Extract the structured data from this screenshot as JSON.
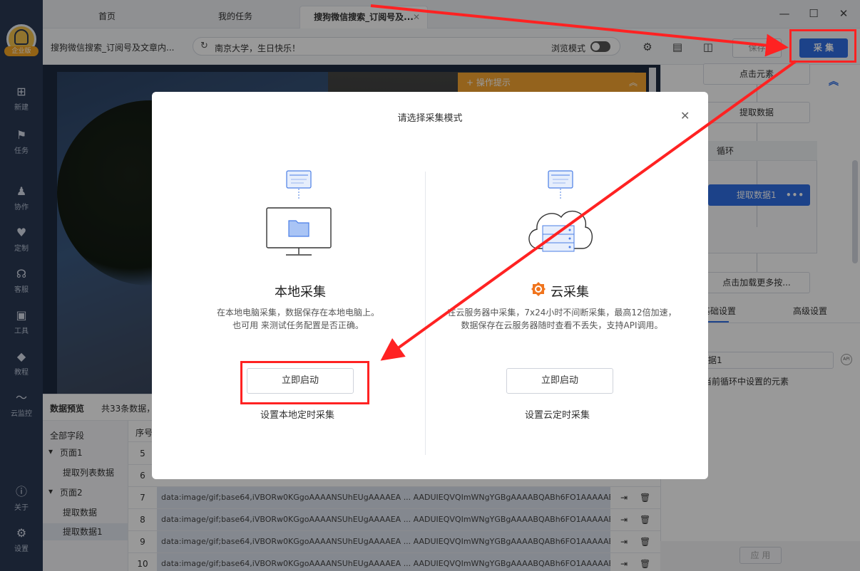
{
  "sidebar": {
    "logo_tag": "企业版",
    "items": [
      {
        "label": "新建",
        "icon": "plus-square-icon"
      },
      {
        "label": "任务",
        "icon": "task-flag-icon"
      },
      {
        "label": "协作",
        "icon": "users-icon"
      },
      {
        "label": "定制",
        "icon": "heart-icon"
      },
      {
        "label": "客服",
        "icon": "headset-icon"
      },
      {
        "label": "工具",
        "icon": "toolbox-icon"
      },
      {
        "label": "教程",
        "icon": "graduation-cap-icon"
      },
      {
        "label": "云监控",
        "icon": "pulse-icon"
      },
      {
        "label": "关于",
        "icon": "info-icon"
      },
      {
        "label": "设置",
        "icon": "gear-icon"
      }
    ]
  },
  "tabs": [
    {
      "label": "首页"
    },
    {
      "label": "我的任务"
    },
    {
      "label": "搜狗微信搜索_订阅号及..."
    }
  ],
  "toolbar": {
    "breadcrumb": "搜狗微信搜索_订阅号及文章内...",
    "address": "南京大学，生日快乐！",
    "browse_mode": "浏览模式",
    "save_label": "保存",
    "collect_label": "采 集"
  },
  "browser": {
    "tip_label": "操作提示"
  },
  "flow": {
    "click_element": "点击元素",
    "extract_data": "提取数据",
    "loop": "循环",
    "extract_data1": "提取数据1",
    "load_more": "点击加载更多按..."
  },
  "settings": {
    "tab_basic": "基础设置",
    "tab_basic_visible": "础设置",
    "tab_advanced": "高级设置",
    "field_name": "据1",
    "hint": "当前循环中设置的元素",
    "apply_label": "应 用"
  },
  "preview": {
    "title": "数据预览",
    "count": "共33条数据，",
    "tree": [
      {
        "label": "全部字段"
      },
      {
        "label": "页面1"
      },
      {
        "label": "提取列表数据"
      },
      {
        "label": "页面2"
      },
      {
        "label": "提取数据"
      },
      {
        "label": "提取数据1"
      }
    ],
    "col_index": "序号",
    "rows": [
      {
        "n": "5",
        "data": ""
      },
      {
        "n": "6",
        "data": ""
      },
      {
        "n": "7",
        "data": "data:image/gif;base64,iVBORw0KGgoAAAANSUhEUgAAAAEA ... AADUIEQVQImWNgYGBgAAAABQABh6FO1AAAAAB..."
      },
      {
        "n": "8",
        "data": "data:image/gif;base64,iVBORw0KGgoAAAANSUhEUgAAAAEA ... AADUIEQVQImWNgYGBgAAAABQABh6FO1AAAAAB..."
      },
      {
        "n": "9",
        "data": "data:image/gif;base64,iVBORw0KGgoAAAANSUhEUgAAAAEA ... AADUIEQVQImWNgYGBgAAAABQABh6FO1AAAAAB..."
      },
      {
        "n": "10",
        "data": "data:image/gif;base64,iVBORw0KGgoAAAANSUhEUgAAAAEA ... AADUIEQVQImWNgYGBgAAAABQABh6FO1AAAAAB..."
      }
    ]
  },
  "modal": {
    "title": "请选择采集模式",
    "local": {
      "title": "本地采集",
      "desc1": "在本地电脑采集，数据保存在本地电脑上。",
      "desc2": "也可用 来测试任务配置是否正确。",
      "button": "立即启动",
      "link": "设置本地定时采集"
    },
    "cloud": {
      "title": "云采集",
      "desc1": "在云服务器中采集，7x24小时不间断采集，最高12倍加速，",
      "desc2": "数据保存在云服务器随时查看不丢失，支持API调用。",
      "button": "立即启动",
      "link": "设置云定时采集"
    }
  },
  "colors": {
    "accent": "#2f6ee5",
    "sidebar": "#2b3954",
    "annotation": "#ff2222",
    "tip": "#f7a531"
  }
}
